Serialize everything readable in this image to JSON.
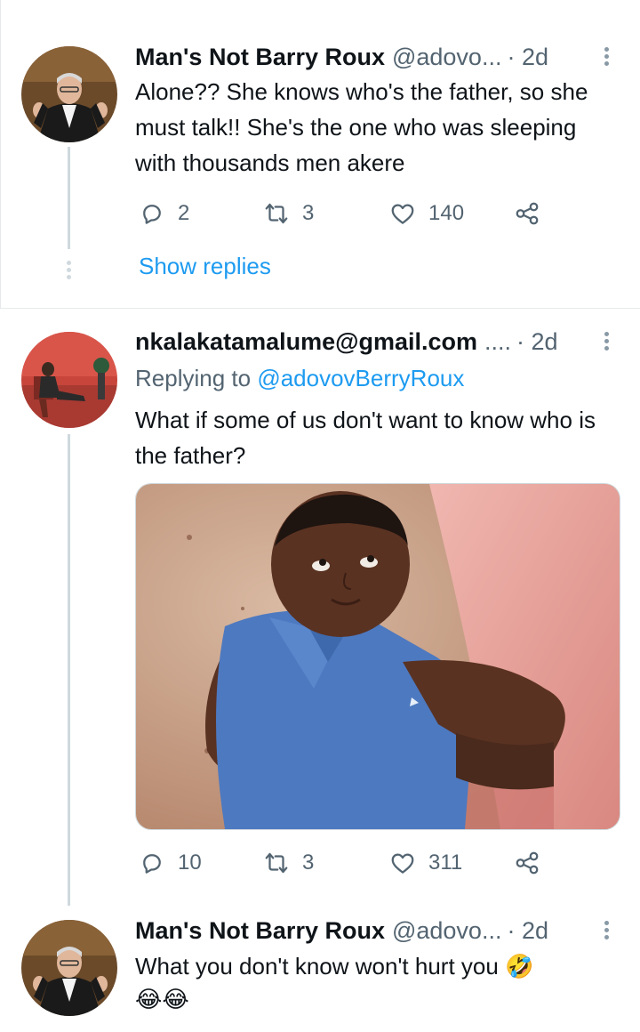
{
  "tweets": [
    {
      "name": "Man's Not Barry Roux",
      "handle": "@adovo...",
      "time": "· 2d",
      "text": "Alone?? She knows who's the father, so she must talk!! She's the one who was sleeping with thousands men akere",
      "replies": "2",
      "retweets": "3",
      "likes": "140",
      "show_replies": "Show replies"
    },
    {
      "name": "nkalakatamalume@gmail.com",
      "handle": "....",
      "time": "· 2d",
      "replying_label": "Replying to",
      "replying_mention": "@adovovBerryRoux",
      "text": "What if some of us don't want to know who is the father?",
      "replies": "10",
      "retweets": "3",
      "likes": "311"
    },
    {
      "name": "Man's Not Barry Roux",
      "handle": "@adovo...",
      "time": "· 2d",
      "text": "What you don't know won't hurt you 🤣",
      "emojis": "😂😂"
    }
  ],
  "icons": {
    "reply": "reply-icon",
    "retweet": "retweet-icon",
    "like": "heart-icon",
    "share": "share-icon",
    "more": "more-icon"
  },
  "colors": {
    "accent": "#1d9bf0",
    "secondary_text": "#536471",
    "thread_line": "#cfd9de"
  }
}
